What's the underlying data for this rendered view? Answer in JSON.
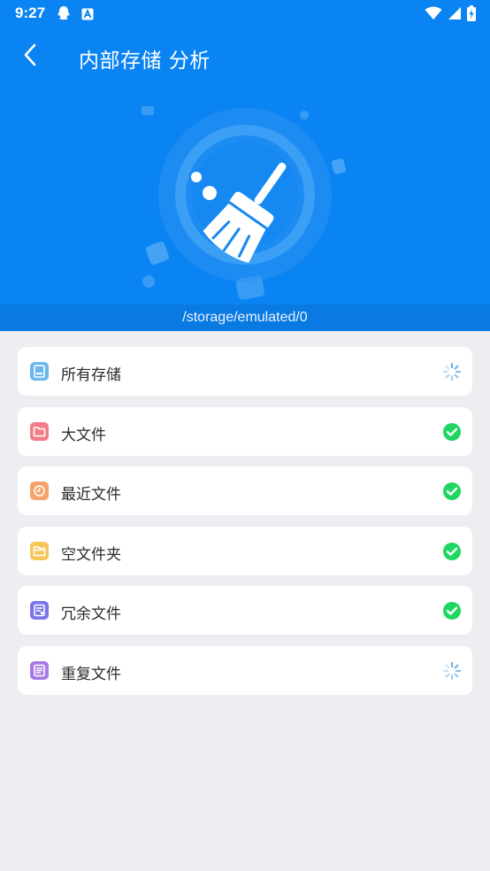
{
  "status_bar": {
    "time": "9:27",
    "left_icons": [
      "qq-icon",
      "font-a-icon"
    ],
    "right_icons": [
      "wifi-icon",
      "signal-icon",
      "battery-charging-icon"
    ]
  },
  "app_bar": {
    "title": "内部存储 分析",
    "back_icon": "back-chevron-icon"
  },
  "path": "/storage/emulated/0",
  "colors": {
    "header_blue": "#0a84f2",
    "path_bar": "#0a7ae3",
    "check_green": "#1ed760",
    "background": "#eceef1"
  },
  "items": [
    {
      "label": "所有存储",
      "icon": "storage-icon",
      "icon_color": "#6cb6ee",
      "status": "loading"
    },
    {
      "label": "大文件",
      "icon": "folder-icon",
      "icon_color": "#f27c87",
      "status": "done"
    },
    {
      "label": "最近文件",
      "icon": "clock-icon",
      "icon_color": "#f7a26a",
      "status": "done"
    },
    {
      "label": "空文件夹",
      "icon": "empty-folder-icon",
      "icon_color": "#f6c65b",
      "status": "done"
    },
    {
      "label": "冗余文件",
      "icon": "redundant-file-icon",
      "icon_color": "#7b74e8",
      "status": "done"
    },
    {
      "label": "重复文件",
      "icon": "duplicate-file-icon",
      "icon_color": "#a77ae8",
      "status": "loading"
    }
  ]
}
